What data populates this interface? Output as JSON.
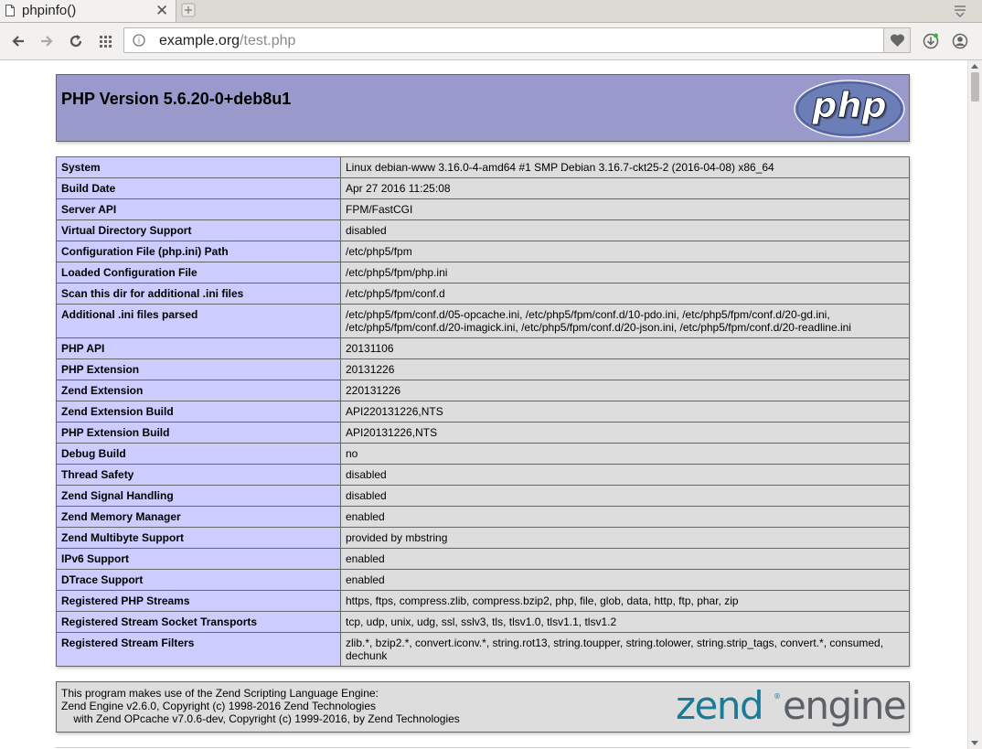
{
  "browser": {
    "tab_title": "phpinfo()",
    "url_host": "example.org",
    "url_path": "/test.php"
  },
  "page": {
    "version_title": "PHP Version 5.6.20-0+deb8u1",
    "logo_text": "php",
    "rows": [
      {
        "key": "System",
        "value": "Linux debian-www 3.16.0-4-amd64 #1 SMP Debian 3.16.7-ckt25-2 (2016-04-08) x86_64"
      },
      {
        "key": "Build Date",
        "value": "Apr 27 2016 11:25:08"
      },
      {
        "key": "Server API",
        "value": "FPM/FastCGI"
      },
      {
        "key": "Virtual Directory Support",
        "value": "disabled"
      },
      {
        "key": "Configuration File (php.ini) Path",
        "value": "/etc/php5/fpm"
      },
      {
        "key": "Loaded Configuration File",
        "value": "/etc/php5/fpm/php.ini"
      },
      {
        "key": "Scan this dir for additional .ini files",
        "value": "/etc/php5/fpm/conf.d"
      },
      {
        "key": "Additional .ini files parsed",
        "value": "/etc/php5/fpm/conf.d/05-opcache.ini, /etc/php5/fpm/conf.d/10-pdo.ini, /etc/php5/fpm/conf.d/20-gd.ini, /etc/php5/fpm/conf.d/20-imagick.ini, /etc/php5/fpm/conf.d/20-json.ini, /etc/php5/fpm/conf.d/20-readline.ini"
      },
      {
        "key": "PHP API",
        "value": "20131106"
      },
      {
        "key": "PHP Extension",
        "value": "20131226"
      },
      {
        "key": "Zend Extension",
        "value": "220131226"
      },
      {
        "key": "Zend Extension Build",
        "value": "API220131226,NTS"
      },
      {
        "key": "PHP Extension Build",
        "value": "API20131226,NTS"
      },
      {
        "key": "Debug Build",
        "value": "no"
      },
      {
        "key": "Thread Safety",
        "value": "disabled"
      },
      {
        "key": "Zend Signal Handling",
        "value": "disabled"
      },
      {
        "key": "Zend Memory Manager",
        "value": "enabled"
      },
      {
        "key": "Zend Multibyte Support",
        "value": "provided by mbstring"
      },
      {
        "key": "IPv6 Support",
        "value": "enabled"
      },
      {
        "key": "DTrace Support",
        "value": "enabled"
      },
      {
        "key": "Registered PHP Streams",
        "value": "https, ftps, compress.zlib, compress.bzip2, php, file, glob, data, http, ftp, phar, zip"
      },
      {
        "key": "Registered Stream Socket Transports",
        "value": "tcp, udp, unix, udg, ssl, sslv3, tls, tlsv1.0, tlsv1.1, tlsv1.2"
      },
      {
        "key": "Registered Stream Filters",
        "value": "zlib.*, bzip2.*, convert.iconv.*, string.rot13, string.toupper, string.tolower, string.strip_tags, convert.*, consumed, dechunk"
      }
    ],
    "zend": {
      "line1": "This program makes use of the Zend Scripting Language Engine:",
      "line2": "Zend Engine v2.6.0, Copyright (c) 1998-2016 Zend Technologies",
      "line3": "    with Zend OPcache v7.0.6-dev, Copyright (c) 1999-2016, by Zend Technologies",
      "logo_word1": "zend",
      "logo_mark": "®",
      "logo_word2": "engine"
    }
  },
  "colors": {
    "header_bg": "#9999cc",
    "key_bg": "#ccccff",
    "value_bg": "#dddddd",
    "zend_teal": "#1b7a96",
    "zend_gray": "#5c6167"
  }
}
